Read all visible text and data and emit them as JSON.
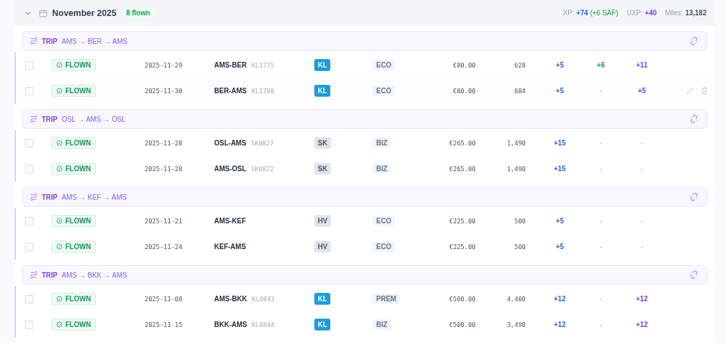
{
  "month": {
    "expanded": true,
    "title": "November 2025",
    "badge": "8 flown",
    "xp_label": "XP:",
    "xp": "+74",
    "saf": "(+6 SAF)",
    "uxp_label": "UXP:",
    "uxp": "+40",
    "miles_label": "Miles:",
    "miles": "13,182"
  },
  "trips": [
    {
      "label": "TRIP",
      "route": "AMS → BER → AMS",
      "flights": [
        {
          "checked": false,
          "hovered": false,
          "status": "FLOWN",
          "date": "2025-11-29",
          "route": "AMS-BER",
          "flight": "KL1775",
          "airline": "KL",
          "color": "#1a9ddb",
          "cabin": "ECO",
          "price": "€80.00",
          "miles": "628",
          "xp": {
            "text": "+5",
            "muted": false
          },
          "saf": {
            "text": "+6",
            "muted": false
          },
          "uxp": {
            "text": "+11",
            "muted": false
          }
        },
        {
          "checked": false,
          "hovered": true,
          "status": "FLOWN",
          "date": "2025-11-30",
          "route": "BER-AMS",
          "flight": "KL1780",
          "airline": "KL",
          "color": "#1a9ddb",
          "cabin": "ECO",
          "price": "€80.00",
          "miles": "684",
          "xp": {
            "text": "+5",
            "muted": false
          },
          "saf": {
            "text": "-",
            "muted": true
          },
          "uxp": {
            "text": "+5",
            "muted": false
          }
        }
      ]
    },
    {
      "label": "TRIP",
      "route": "OSL → AMS → OSL",
      "flights": [
        {
          "checked": false,
          "hovered": false,
          "status": "FLOWN",
          "date": "2025-11-28",
          "route": "OSL-AMS",
          "flight": "SK0827",
          "airline": "SK",
          "color": "#e2e6ec",
          "cabin": "BIZ",
          "price": "€265.00",
          "miles": "1,490",
          "xp": {
            "text": "+15",
            "muted": false
          },
          "saf": {
            "text": "-",
            "muted": true
          },
          "uxp": {
            "text": "-",
            "muted": true
          }
        },
        {
          "checked": false,
          "hovered": false,
          "status": "FLOWN",
          "date": "2025-11-28",
          "route": "AMS-OSL",
          "flight": "SK0822",
          "airline": "SK",
          "color": "#e2e6ec",
          "cabin": "BIZ",
          "price": "€265.00",
          "miles": "1,490",
          "xp": {
            "text": "+15",
            "muted": false
          },
          "saf": {
            "text": "-",
            "muted": true
          },
          "uxp": {
            "text": "-",
            "muted": true
          }
        }
      ]
    },
    {
      "label": "TRIP",
      "route": "AMS → KEF → AMS",
      "flights": [
        {
          "checked": false,
          "hovered": false,
          "status": "FLOWN",
          "date": "2025-11-21",
          "route": "AMS-KEF",
          "airline": "HV",
          "color": "#e2e6ec",
          "cabin": "ECO",
          "price": "€225.00",
          "miles": "500",
          "xp": {
            "text": "+5",
            "muted": false
          },
          "saf": {
            "text": "-",
            "muted": true
          },
          "uxp": {
            "text": "-",
            "muted": true
          }
        },
        {
          "checked": false,
          "hovered": false,
          "status": "FLOWN",
          "date": "2025-11-24",
          "route": "KEF-AMS",
          "airline": "HV",
          "color": "#e2e6ec",
          "cabin": "ECO",
          "price": "€225.00",
          "miles": "500",
          "xp": {
            "text": "+5",
            "muted": false
          },
          "saf": {
            "text": "-",
            "muted": true
          },
          "uxp": {
            "text": "-",
            "muted": true
          }
        }
      ]
    },
    {
      "label": "TRIP",
      "route": "AMS → BKK → AMS",
      "flights": [
        {
          "checked": false,
          "hovered": false,
          "status": "FLOWN",
          "date": "2025-11-08",
          "route": "AMS-BKK",
          "flight": "KL0843",
          "airline": "KL",
          "color": "#1a9ddb",
          "cabin": "PREM",
          "price": "€500.00",
          "miles": "4,400",
          "xp": {
            "text": "+12",
            "muted": false
          },
          "saf": {
            "text": "-",
            "muted": true
          },
          "uxp": {
            "text": "+12",
            "muted": false
          }
        },
        {
          "checked": false,
          "hovered": false,
          "status": "FLOWN",
          "date": "2025-11-15",
          "route": "BKK-AMS",
          "flight": "KL0844",
          "airline": "KL",
          "color": "#1a9ddb",
          "cabin": "BIZ",
          "price": "€500.00",
          "miles": "3,490",
          "xp": {
            "text": "+12",
            "muted": false
          },
          "saf": {
            "text": "-",
            "muted": true
          },
          "uxp": {
            "text": "+12",
            "muted": false
          }
        }
      ]
    }
  ]
}
